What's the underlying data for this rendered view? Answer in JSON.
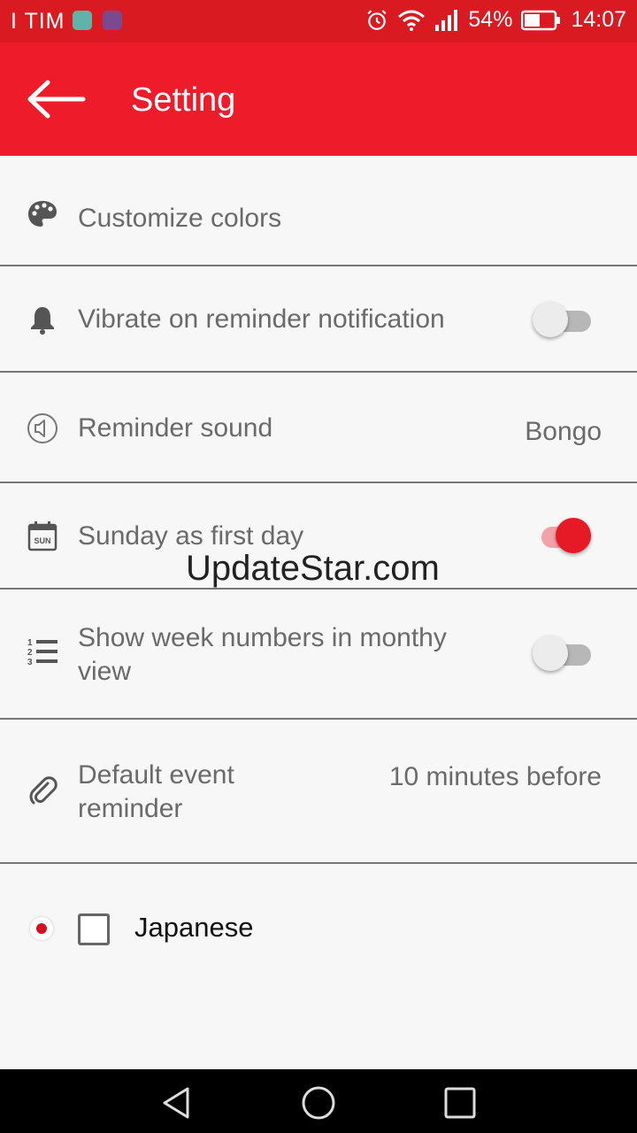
{
  "status_bar": {
    "carrier": "I TIM",
    "battery": "54%",
    "time": "14:07"
  },
  "header": {
    "title": "Setting"
  },
  "settings": {
    "customize_colors": {
      "label": "Customize colors"
    },
    "vibrate": {
      "label": "Vibrate on reminder notification",
      "enabled": false
    },
    "reminder_sound": {
      "label": "Reminder sound",
      "value": "Bongo"
    },
    "sunday_first": {
      "label": "Sunday as first day",
      "enabled": true
    },
    "week_numbers": {
      "label_line1": "Show week numbers in monthy",
      "label_line2": "view",
      "enabled": false
    },
    "default_reminder": {
      "label_line1": "Default event",
      "label_line2": "reminder",
      "value": "10 minutes before"
    }
  },
  "watermark": "UpdateStar.com",
  "language": {
    "label": "Japanese",
    "checked": false
  },
  "colors": {
    "status_bar": "#d91a20",
    "app_bar": "#ee1c2a",
    "accent": "#e51a26"
  }
}
